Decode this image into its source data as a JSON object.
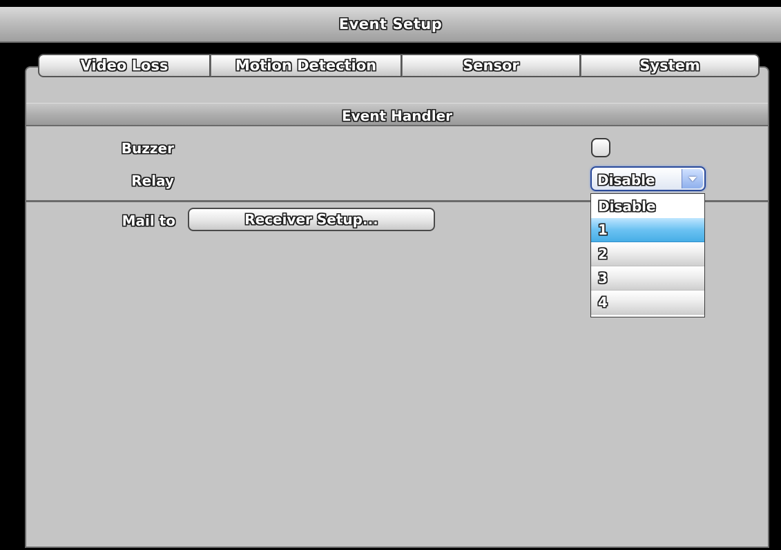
{
  "window": {
    "title": "Event Setup"
  },
  "tabs": [
    {
      "label": "Video Loss"
    },
    {
      "label": "Motion Detection"
    },
    {
      "label": "Sensor"
    },
    {
      "label": "System",
      "active": true
    }
  ],
  "section": {
    "title": "Event Handler"
  },
  "fields": {
    "buzzer": {
      "label": "Buzzer",
      "checked": false
    },
    "relay": {
      "label": "Relay",
      "value": "Disable"
    }
  },
  "mail": {
    "label": "Mail to",
    "button_label": "Receiver Setup..."
  },
  "relay_dropdown": {
    "open": true,
    "options": [
      "Disable",
      "1",
      "2",
      "3",
      "4"
    ],
    "highlighted": "1"
  },
  "colors": {
    "highlight": "#47aee6",
    "panel": "#c5c5c5",
    "focus_border": "#2a4a9a"
  }
}
